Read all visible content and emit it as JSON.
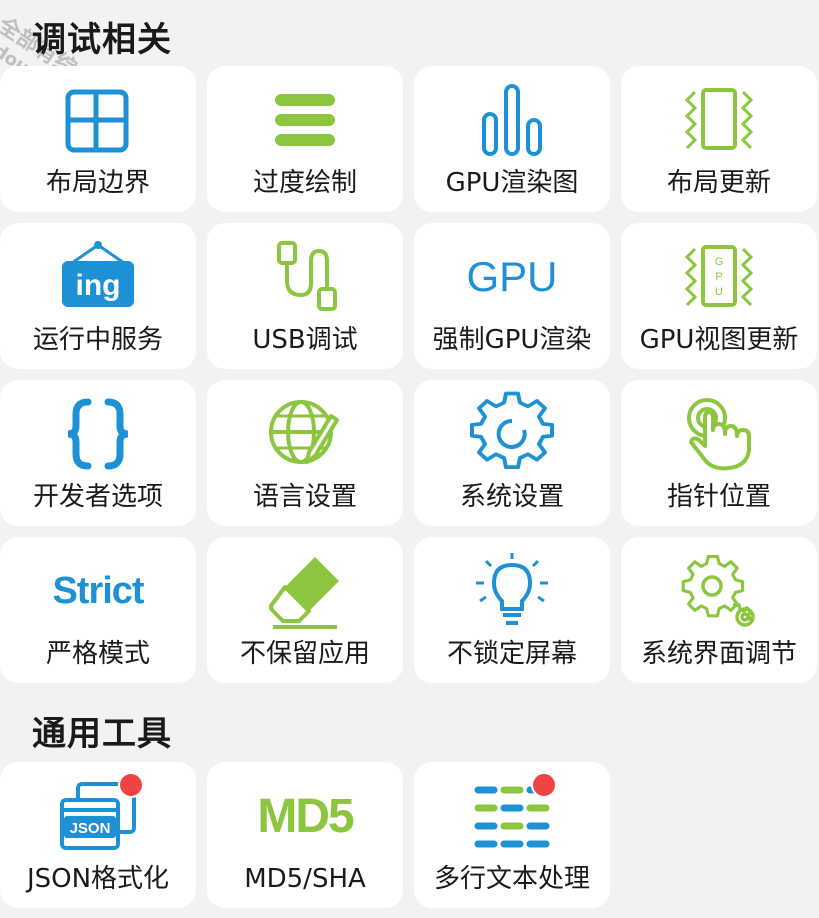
{
  "colors": {
    "blue": "#1e90d6",
    "green": "#8cc63f",
    "red": "#ef4444",
    "tile_bg": "#ffffff",
    "page_bg": "#f2f2f2"
  },
  "sections": [
    {
      "title": "调试相关",
      "tiles": [
        {
          "label": "布局边界",
          "icon": "layout-bounds-icon"
        },
        {
          "label": "过度绘制",
          "icon": "overdraw-icon"
        },
        {
          "label": "GPU渲染图",
          "icon": "gpu-render-chart-icon"
        },
        {
          "label": "布局更新",
          "icon": "layout-update-icon"
        },
        {
          "label": "运行中服务",
          "icon": "running-services-icon",
          "icon_text": "ing"
        },
        {
          "label": "USB调试",
          "icon": "usb-cable-icon"
        },
        {
          "label": "强制GPU渲染",
          "icon": "gpu-text-icon",
          "icon_text": "GPU"
        },
        {
          "label": "GPU视图更新",
          "icon": "gpu-view-update-icon",
          "icon_text": "GPU"
        },
        {
          "label": "开发者选项",
          "icon": "curly-braces-icon"
        },
        {
          "label": "语言设置",
          "icon": "globe-pen-icon"
        },
        {
          "label": "系统设置",
          "icon": "gear-icon"
        },
        {
          "label": "指针位置",
          "icon": "pointer-hand-icon"
        },
        {
          "label": "严格模式",
          "icon": "strict-text-icon",
          "icon_text": "Strict"
        },
        {
          "label": "不保留应用",
          "icon": "eraser-icon"
        },
        {
          "label": "不锁定屏幕",
          "icon": "lightbulb-icon"
        },
        {
          "label": "系统界面调节",
          "icon": "gears-icon"
        }
      ]
    },
    {
      "title": "通用工具",
      "tiles": [
        {
          "label": "JSON格式化",
          "icon": "json-windows-icon",
          "icon_text": "JSON",
          "badge": true
        },
        {
          "label": "MD5/SHA",
          "icon": "md5-text-icon",
          "icon_text": "MD5"
        },
        {
          "label": "多行文本处理",
          "icon": "multiline-text-icon",
          "badge": true
        }
      ]
    }
  ],
  "watermark": {
    "line1": "全部有综合资源网",
    "line2": "douyouvip.com"
  }
}
